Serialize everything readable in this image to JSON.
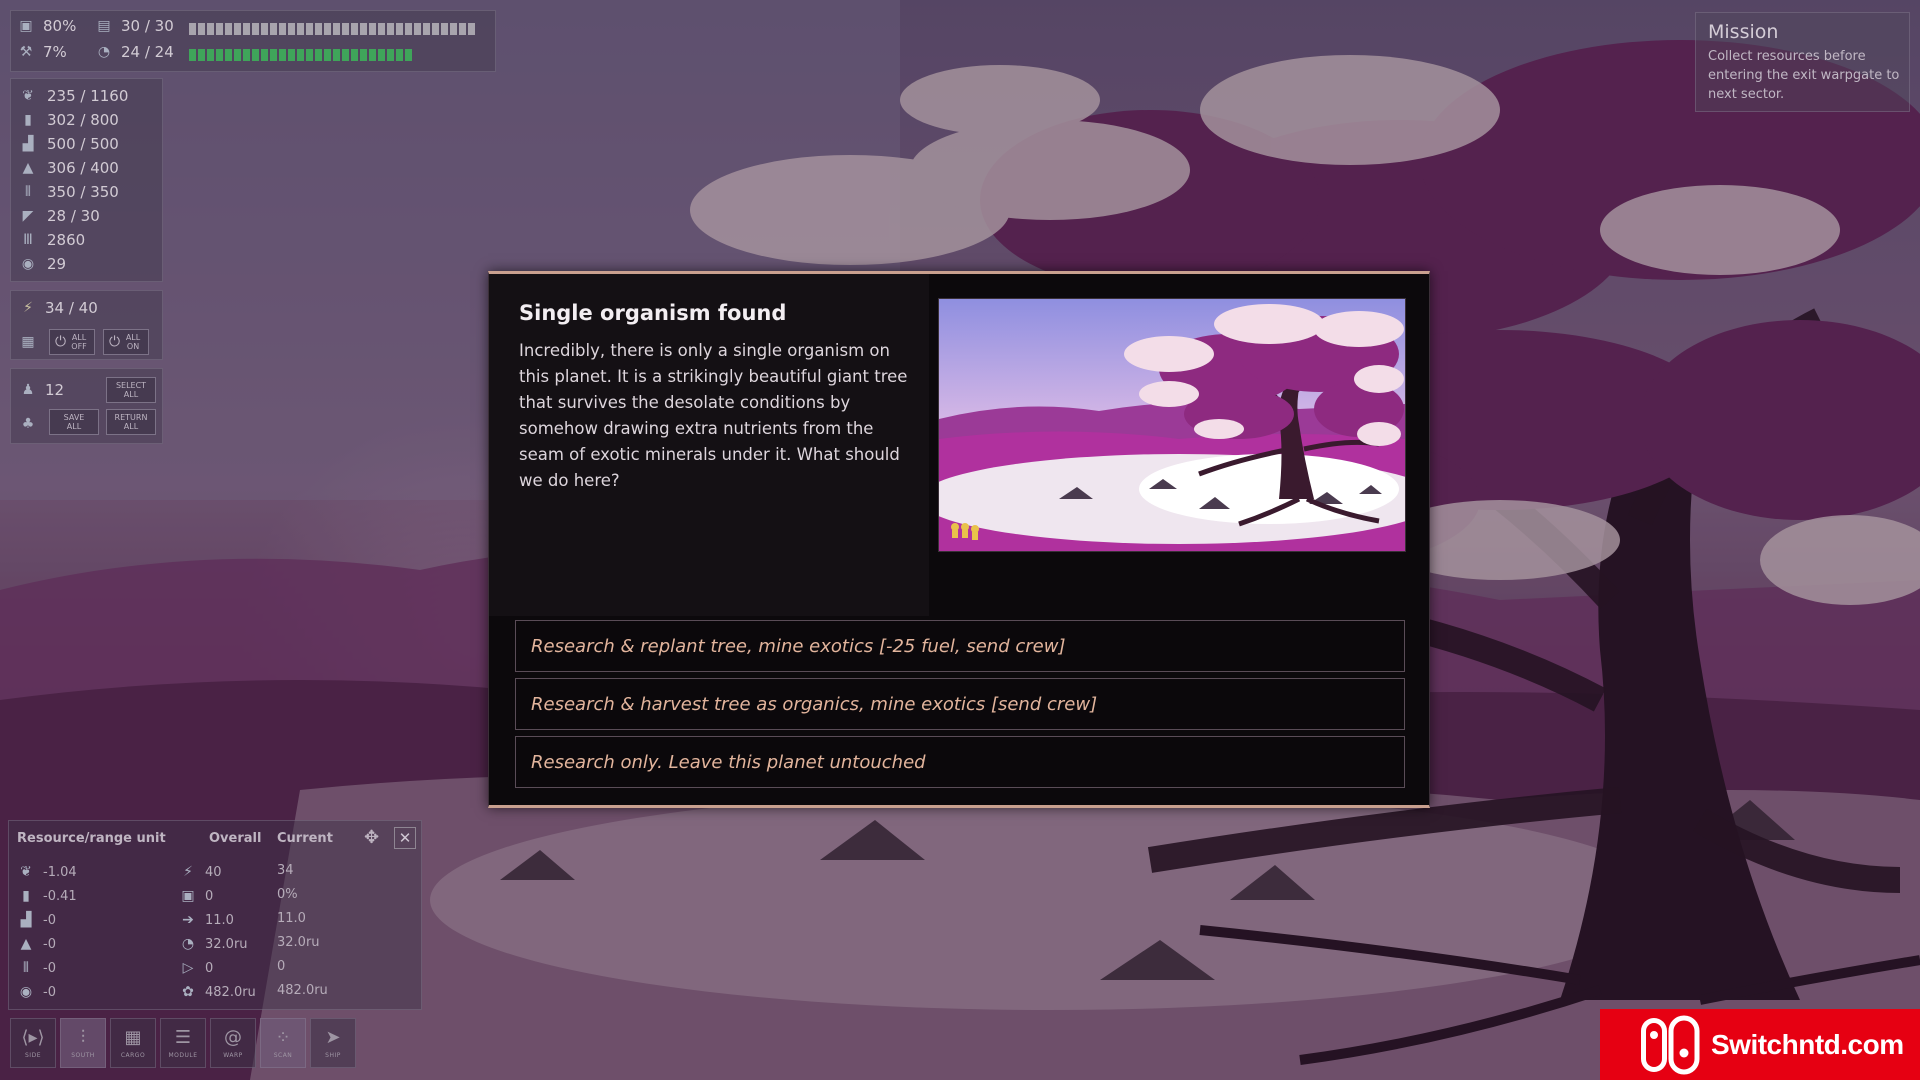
{
  "top_status": {
    "hull_pct": "80%",
    "cargo": "30 / 30",
    "damage_pct": "7%",
    "fuel_bar": "24 / 24",
    "bar1_fill": 1.0,
    "bar2_fill": 1.0
  },
  "resources": [
    {
      "icon": "organics-icon",
      "value": "235 / 1160"
    },
    {
      "icon": "fuel-icon",
      "value": "302 / 800"
    },
    {
      "icon": "metal-icon",
      "value": "500 / 500"
    },
    {
      "icon": "exotics-icon",
      "value": "306 / 400"
    },
    {
      "icon": "synthetics-icon",
      "value": "350 / 350"
    },
    {
      "icon": "crew-capacity-icon",
      "value": "28 / 30"
    },
    {
      "icon": "credits-icon",
      "value": "2860"
    },
    {
      "icon": "research-icon",
      "value": "29"
    }
  ],
  "power": {
    "value": "34 / 40",
    "all_off": "ALL OFF",
    "all_on": "ALL ON"
  },
  "crew": {
    "count": "12",
    "select_all": "SELECT ALL",
    "save_all": "SAVE ALL",
    "return_all": "RETURN ALL"
  },
  "mission": {
    "title": "Mission",
    "text": "Collect resources before entering the exit warpgate to next sector."
  },
  "range_panel": {
    "col1": "Resource/range unit",
    "col2": "Overall",
    "col3": "Current",
    "rows": [
      {
        "rate": "-1.04",
        "overall": "40",
        "current": "34"
      },
      {
        "rate": "-0.41",
        "overall": "0",
        "current": "0%"
      },
      {
        "rate": "-0",
        "overall": "11.0",
        "current": "11.0"
      },
      {
        "rate": "-0",
        "overall": "32.0ru",
        "current": "32.0ru"
      },
      {
        "rate": "-0",
        "overall": "0",
        "current": "0"
      },
      {
        "rate": "-0",
        "overall": "482.0ru",
        "current": "482.0ru"
      }
    ]
  },
  "toolbar": [
    {
      "label": "SIDE",
      "glyph": "⟨▸⟩"
    },
    {
      "label": "SOUTH",
      "glyph": "⫶"
    },
    {
      "label": "CARGO",
      "glyph": "▦"
    },
    {
      "label": "MODULE",
      "glyph": "☰"
    },
    {
      "label": "WARP",
      "glyph": "@"
    },
    {
      "label": "SCAN",
      "glyph": "⁘"
    },
    {
      "label": "SHIP",
      "glyph": "➤"
    }
  ],
  "dialog": {
    "title": "Single organism found",
    "body": "Incredibly, there is only a single organism on this planet. It is a strikingly beautiful giant tree that survives the desolate conditions by somehow drawing extra nutrients from the seam of exotic minerals under it.  What should we do here?",
    "choices": [
      "Research & replant tree, mine exotics [-25 fuel, send crew]",
      "Research & harvest tree as organics, mine exotics [send crew]",
      "Research only. Leave this planet untouched"
    ]
  },
  "watermark": {
    "text": "Switchntd.com"
  },
  "colors": {
    "choice_text": "#e2b49c",
    "dialog_border": "#c9a08f",
    "bar_fill": "#3fa45a",
    "bar_fill_alt": "#a8a4ad",
    "watermark_bg": "#e60012"
  }
}
